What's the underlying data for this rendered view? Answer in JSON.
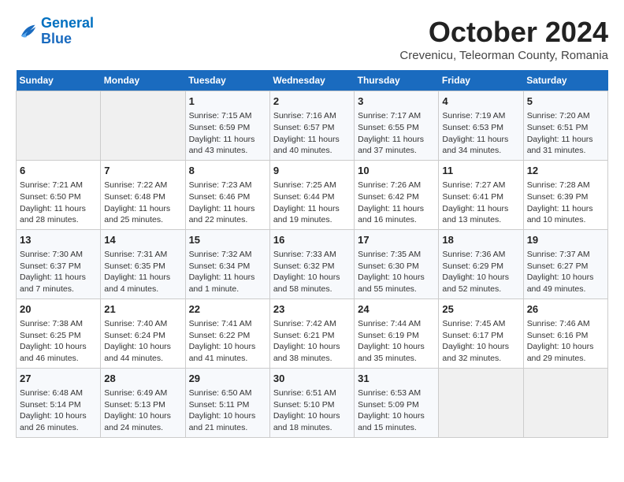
{
  "logo": {
    "line1": "General",
    "line2": "Blue"
  },
  "title": "October 2024",
  "location": "Crevenicu, Teleorman County, Romania",
  "days_of_week": [
    "Sunday",
    "Monday",
    "Tuesday",
    "Wednesday",
    "Thursday",
    "Friday",
    "Saturday"
  ],
  "weeks": [
    [
      {
        "day": "",
        "info": ""
      },
      {
        "day": "",
        "info": ""
      },
      {
        "day": "1",
        "info": "Sunrise: 7:15 AM\nSunset: 6:59 PM\nDaylight: 11 hours and 43 minutes."
      },
      {
        "day": "2",
        "info": "Sunrise: 7:16 AM\nSunset: 6:57 PM\nDaylight: 11 hours and 40 minutes."
      },
      {
        "day": "3",
        "info": "Sunrise: 7:17 AM\nSunset: 6:55 PM\nDaylight: 11 hours and 37 minutes."
      },
      {
        "day": "4",
        "info": "Sunrise: 7:19 AM\nSunset: 6:53 PM\nDaylight: 11 hours and 34 minutes."
      },
      {
        "day": "5",
        "info": "Sunrise: 7:20 AM\nSunset: 6:51 PM\nDaylight: 11 hours and 31 minutes."
      }
    ],
    [
      {
        "day": "6",
        "info": "Sunrise: 7:21 AM\nSunset: 6:50 PM\nDaylight: 11 hours and 28 minutes."
      },
      {
        "day": "7",
        "info": "Sunrise: 7:22 AM\nSunset: 6:48 PM\nDaylight: 11 hours and 25 minutes."
      },
      {
        "day": "8",
        "info": "Sunrise: 7:23 AM\nSunset: 6:46 PM\nDaylight: 11 hours and 22 minutes."
      },
      {
        "day": "9",
        "info": "Sunrise: 7:25 AM\nSunset: 6:44 PM\nDaylight: 11 hours and 19 minutes."
      },
      {
        "day": "10",
        "info": "Sunrise: 7:26 AM\nSunset: 6:42 PM\nDaylight: 11 hours and 16 minutes."
      },
      {
        "day": "11",
        "info": "Sunrise: 7:27 AM\nSunset: 6:41 PM\nDaylight: 11 hours and 13 minutes."
      },
      {
        "day": "12",
        "info": "Sunrise: 7:28 AM\nSunset: 6:39 PM\nDaylight: 11 hours and 10 minutes."
      }
    ],
    [
      {
        "day": "13",
        "info": "Sunrise: 7:30 AM\nSunset: 6:37 PM\nDaylight: 11 hours and 7 minutes."
      },
      {
        "day": "14",
        "info": "Sunrise: 7:31 AM\nSunset: 6:35 PM\nDaylight: 11 hours and 4 minutes."
      },
      {
        "day": "15",
        "info": "Sunrise: 7:32 AM\nSunset: 6:34 PM\nDaylight: 11 hours and 1 minute."
      },
      {
        "day": "16",
        "info": "Sunrise: 7:33 AM\nSunset: 6:32 PM\nDaylight: 10 hours and 58 minutes."
      },
      {
        "day": "17",
        "info": "Sunrise: 7:35 AM\nSunset: 6:30 PM\nDaylight: 10 hours and 55 minutes."
      },
      {
        "day": "18",
        "info": "Sunrise: 7:36 AM\nSunset: 6:29 PM\nDaylight: 10 hours and 52 minutes."
      },
      {
        "day": "19",
        "info": "Sunrise: 7:37 AM\nSunset: 6:27 PM\nDaylight: 10 hours and 49 minutes."
      }
    ],
    [
      {
        "day": "20",
        "info": "Sunrise: 7:38 AM\nSunset: 6:25 PM\nDaylight: 10 hours and 46 minutes."
      },
      {
        "day": "21",
        "info": "Sunrise: 7:40 AM\nSunset: 6:24 PM\nDaylight: 10 hours and 44 minutes."
      },
      {
        "day": "22",
        "info": "Sunrise: 7:41 AM\nSunset: 6:22 PM\nDaylight: 10 hours and 41 minutes."
      },
      {
        "day": "23",
        "info": "Sunrise: 7:42 AM\nSunset: 6:21 PM\nDaylight: 10 hours and 38 minutes."
      },
      {
        "day": "24",
        "info": "Sunrise: 7:44 AM\nSunset: 6:19 PM\nDaylight: 10 hours and 35 minutes."
      },
      {
        "day": "25",
        "info": "Sunrise: 7:45 AM\nSunset: 6:17 PM\nDaylight: 10 hours and 32 minutes."
      },
      {
        "day": "26",
        "info": "Sunrise: 7:46 AM\nSunset: 6:16 PM\nDaylight: 10 hours and 29 minutes."
      }
    ],
    [
      {
        "day": "27",
        "info": "Sunrise: 6:48 AM\nSunset: 5:14 PM\nDaylight: 10 hours and 26 minutes."
      },
      {
        "day": "28",
        "info": "Sunrise: 6:49 AM\nSunset: 5:13 PM\nDaylight: 10 hours and 24 minutes."
      },
      {
        "day": "29",
        "info": "Sunrise: 6:50 AM\nSunset: 5:11 PM\nDaylight: 10 hours and 21 minutes."
      },
      {
        "day": "30",
        "info": "Sunrise: 6:51 AM\nSunset: 5:10 PM\nDaylight: 10 hours and 18 minutes."
      },
      {
        "day": "31",
        "info": "Sunrise: 6:53 AM\nSunset: 5:09 PM\nDaylight: 10 hours and 15 minutes."
      },
      {
        "day": "",
        "info": ""
      },
      {
        "day": "",
        "info": ""
      }
    ]
  ]
}
